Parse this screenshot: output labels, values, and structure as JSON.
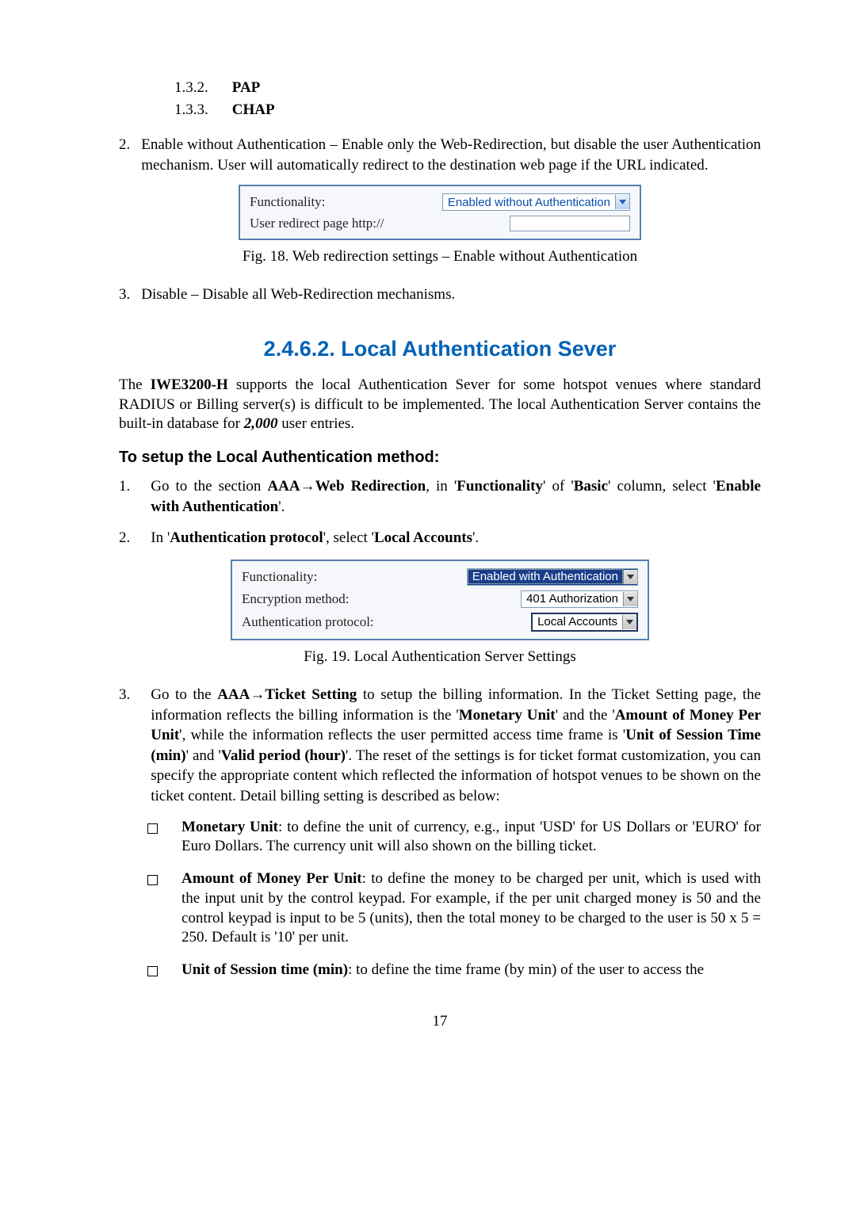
{
  "sublist": {
    "item1_num": "1.3.2.",
    "item1_label": "PAP",
    "item2_num": "1.3.3.",
    "item2_label": "CHAP"
  },
  "item2": {
    "num": "2.",
    "text": "Enable without Authentication – Enable only the Web-Redirection, but disable the user Authentication mechanism. User will automatically redirect to the destination web page if the URL indicated."
  },
  "fig18": {
    "row1_label": "Functionality:",
    "row1_value": "Enabled without Authentication",
    "row2_label": "User redirect page http://",
    "caption": "Fig. 18. Web redirection settings – Enable without Authentication"
  },
  "item3": {
    "num": "3.",
    "text": "Disable – Disable all Web-Redirection mechanisms."
  },
  "section_title": "2.4.6.2. Local Authentication Sever",
  "intro_para_prefix": "The ",
  "intro_para_model": "IWE3200-H",
  "intro_para_mid": " supports the local Authentication Sever for some hotspot venues where standard RADIUS or Billing server(s) is difficult to be implemented. The local Authentication Server contains the built-in database for ",
  "intro_para_num": "2,000",
  "intro_para_end": " user entries.",
  "subhead": "To setup the Local Authentication method:",
  "step1": {
    "num": "1.",
    "t1": "Go to the section ",
    "t2": "AAA",
    "t2b": "Web Redirection",
    "t3": ", in '",
    "t4": "Functionality",
    "t5": "' of '",
    "t6": "Basic",
    "t7": "' column, select '",
    "t8": "Enable with Authentication",
    "t9": "'."
  },
  "step2": {
    "num": "2.",
    "t1": "In '",
    "t2": "Authentication protocol",
    "t3": "', select '",
    "t4": "Local Accounts",
    "t5": "'."
  },
  "fig19": {
    "r1_label": "Functionality:",
    "r1_value": "Enabled with Authentication",
    "r2_label": "Encryption method:",
    "r2_value": "401 Authorization",
    "r3_label": "Authentication protocol:",
    "r3_value": "Local Accounts",
    "caption": "Fig. 19. Local Authentication Server Settings"
  },
  "step3": {
    "num": "3.",
    "t1": "Go to the ",
    "t2": "AAA",
    "t2b": "Ticket Setting",
    "t3": " to setup the billing information. In the Ticket Setting page, the information reflects the billing information is the '",
    "t4": "Monetary Unit",
    "t5": "' and the '",
    "t6": "Amount of Money Per Unit",
    "t7": "', while the information reflects the user permitted access time frame is '",
    "t8": "Unit of Session Time (min)",
    "t9": "' and '",
    "t10": "Valid period (hour)",
    "t11": "'. The reset of the settings is for ticket format customization, you can specify the appropriate content which reflected the information of hotspot venues to be shown on the ticket content. Detail billing setting is described as below:"
  },
  "bullet1": {
    "b1": "Monetary Unit",
    "t": ": to define the unit of currency, e.g., input 'USD' for US Dollars or 'EURO' for Euro Dollars. The currency unit will also shown on the billing ticket."
  },
  "bullet2": {
    "b1": "Amount of Money Per Unit",
    "t": ": to define the money to be charged per unit, which is used with the input unit by the control keypad. For example, if the per unit charged money is 50 and the control keypad is input to be 5 (units), then the total money to be charged to the user is 50 x 5 = 250. Default is '10' per unit."
  },
  "bullet3": {
    "b1": "Unit of Session time (min)",
    "t": ": to define the time frame (by min) of the user to access the"
  },
  "pagenum": "17"
}
